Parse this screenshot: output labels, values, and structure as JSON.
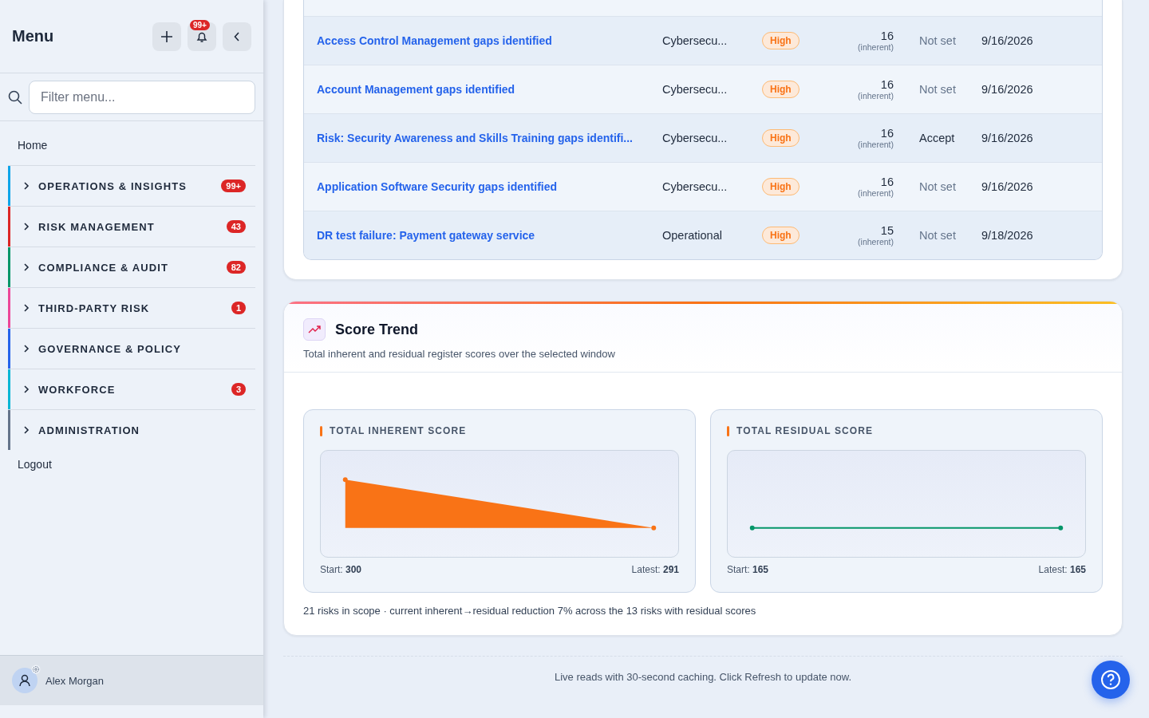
{
  "sidebar": {
    "title": "Menu",
    "notification_badge": "99+",
    "filter": {
      "placeholder": "Filter menu..."
    },
    "home": "Home",
    "groups": [
      {
        "label": "OPERATIONS & INSIGHTS",
        "badge": "99+",
        "color": "#0ea5e9"
      },
      {
        "label": "RISK MANAGEMENT",
        "badge": "43",
        "color": "#dc2626"
      },
      {
        "label": "COMPLIANCE & AUDIT",
        "badge": "82",
        "color": "#059669"
      },
      {
        "label": "THIRD-PARTY RISK",
        "badge": "1",
        "color": "#ec4899"
      },
      {
        "label": "GOVERNANCE & POLICY",
        "color": "#2563eb"
      },
      {
        "label": "WORKFORCE",
        "badge": "3",
        "color": "#06b6d4"
      },
      {
        "label": "ADMINISTRATION",
        "color": "#64748b"
      }
    ],
    "logout": "Logout",
    "user": "Alex Morgan"
  },
  "risks": {
    "rows": [
      {
        "title": "Access Control Management gaps identified",
        "category": "Cybersecu...",
        "severity": "High",
        "score": "16",
        "score_note": "(inherent)",
        "treatment": "Not set",
        "treatment_set": false,
        "due": "9/16/2026"
      },
      {
        "title": "Account Management gaps identified",
        "category": "Cybersecu...",
        "severity": "High",
        "score": "16",
        "score_note": "(inherent)",
        "treatment": "Not set",
        "treatment_set": false,
        "due": "9/16/2026"
      },
      {
        "title": "Risk: Security Awareness and Skills Training gaps identifi...",
        "category": "Cybersecu...",
        "severity": "High",
        "score": "16",
        "score_note": "(inherent)",
        "treatment": "Accept",
        "treatment_set": true,
        "due": "9/16/2026"
      },
      {
        "title": "Application Software Security gaps identified",
        "category": "Cybersecu...",
        "severity": "High",
        "score": "16",
        "score_note": "(inherent)",
        "treatment": "Not set",
        "treatment_set": false,
        "due": "9/16/2026"
      },
      {
        "title": "DR test failure: Payment gateway service",
        "category": "Operational",
        "severity": "High",
        "score": "15",
        "score_note": "(inherent)",
        "treatment": "Not set",
        "treatment_set": false,
        "due": "9/18/2026"
      }
    ]
  },
  "score_trend": {
    "title": "Score Trend",
    "subtitle": "Total inherent and residual register scores over the selected window",
    "panels": [
      {
        "label": "TOTAL INHERENT SCORE",
        "kind": "area",
        "color": "#f97316",
        "start_label": "Start:",
        "start": "300",
        "latest_label": "Latest:",
        "latest": "291"
      },
      {
        "label": "TOTAL RESIDUAL SCORE",
        "kind": "line",
        "color": "#059669",
        "start_label": "Start:",
        "start": "165",
        "latest_label": "Latest:",
        "latest": "165"
      }
    ],
    "summary": "21 risks in scope · current inherent→residual reduction 7% across the 13 risks with residual scores"
  },
  "footer": "Live reads with 30-second caching. Click Refresh to update now."
}
